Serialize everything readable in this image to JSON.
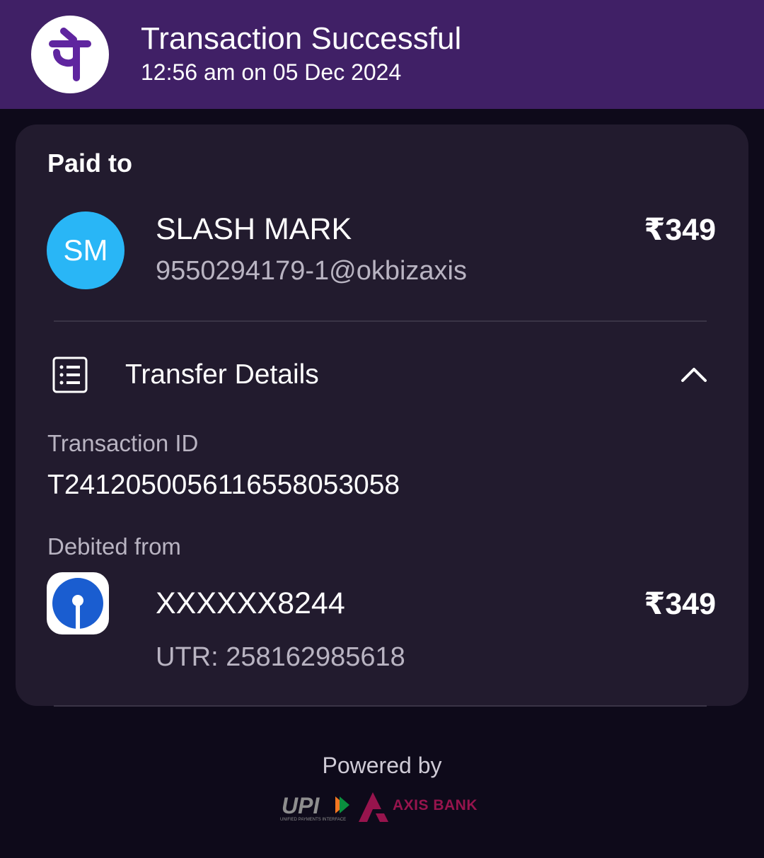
{
  "header": {
    "title": "Transaction Successful",
    "subtitle": "12:56 am on 05 Dec 2024",
    "logo_icon": "phonepe-logo-icon",
    "background": "#402066"
  },
  "payee": {
    "section_label": "Paid to",
    "initials": "SM",
    "name": "SLASH MARK",
    "upi_id": "9550294179-1@okbizaxis",
    "amount": "₹349",
    "avatar_color": "#29b6f6"
  },
  "transfer_details": {
    "label": "Transfer Details",
    "icon": "receipt-list-icon",
    "toggle_icon": "chevron-up-icon",
    "transaction_id_label": "Transaction ID",
    "transaction_id": "T2412050056116558053058",
    "debited_from_label": "Debited from",
    "bank_icon": "sbi-logo-icon",
    "account_number": "XXXXXX8244",
    "utr": "UTR: 258162985618",
    "amount": "₹349"
  },
  "footer": {
    "powered_by": "Powered by",
    "upi_logo_text": "UPI",
    "upi_logo_tagline": "UNIFIED PAYMENTS INTERFACE",
    "bank_name": "AXIS BANK",
    "bank_color": "#97144d"
  }
}
